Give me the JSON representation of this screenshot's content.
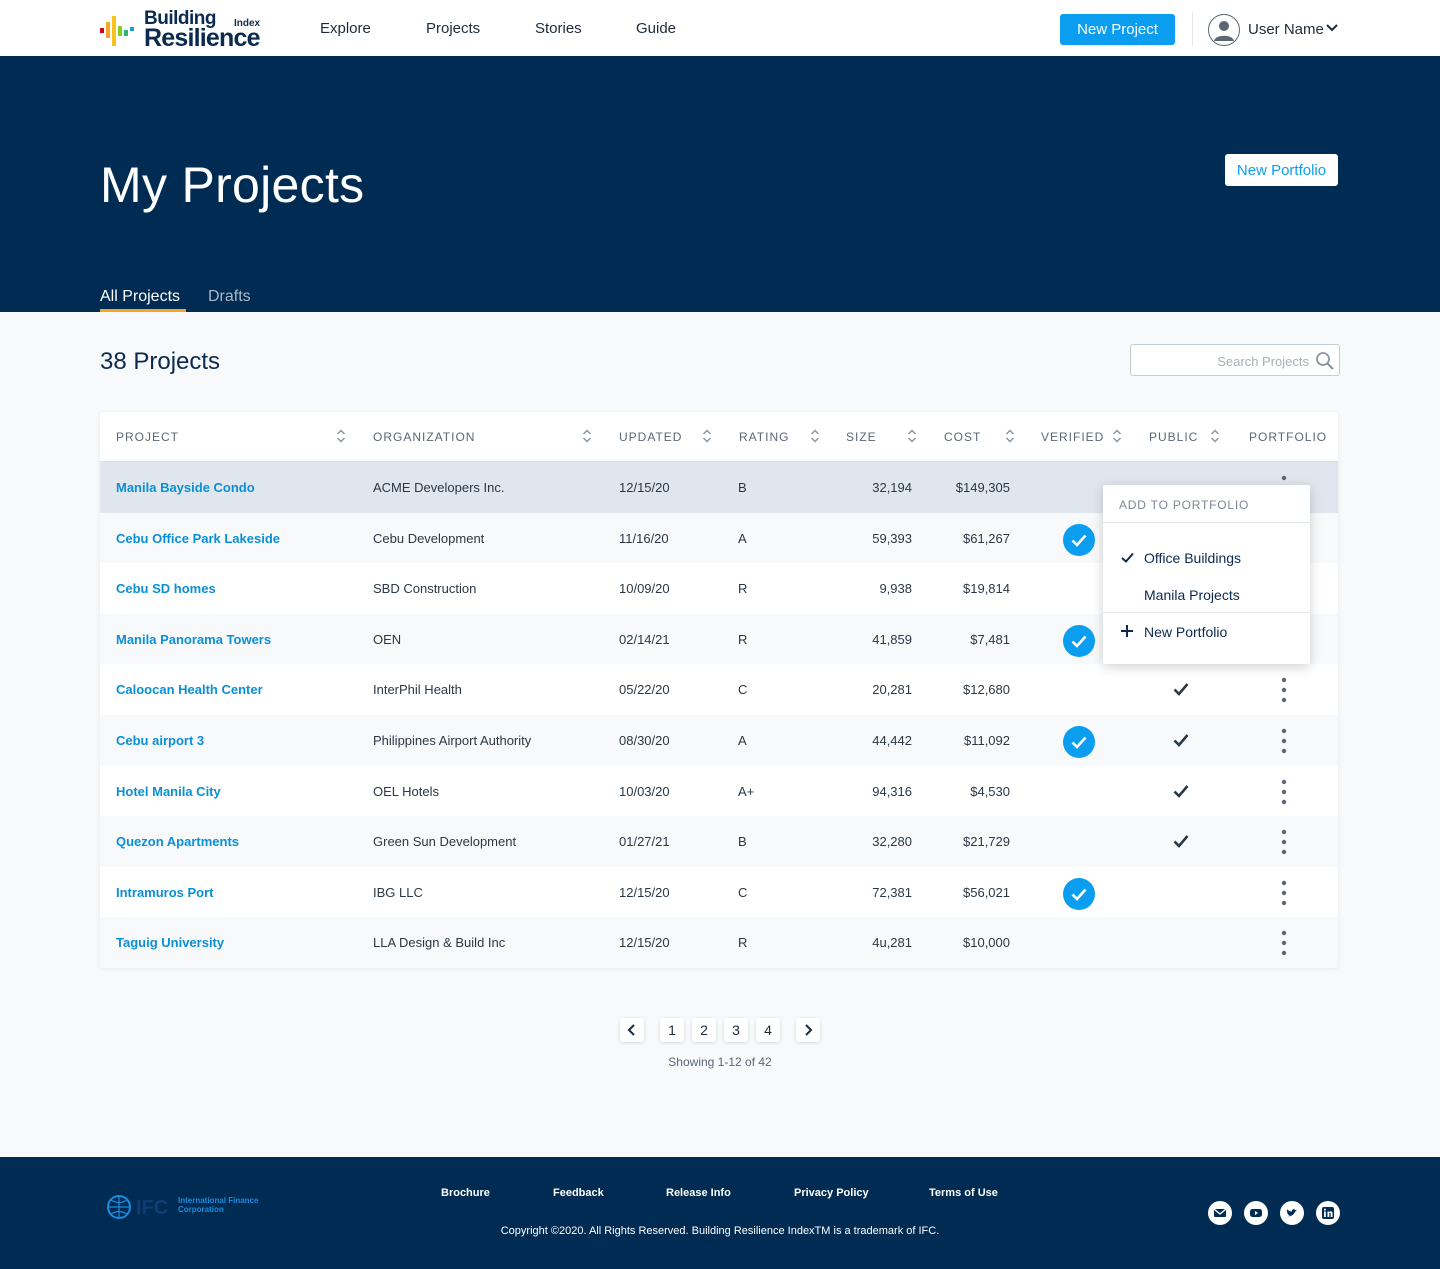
{
  "app": {
    "logo_line1": "Building",
    "logo_line2": "Resilience",
    "logo_index": "Index"
  },
  "nav": {
    "links": [
      "Explore",
      "Projects",
      "Stories",
      "Guide"
    ],
    "new_project": "New Project",
    "user_name": "User Name"
  },
  "hero": {
    "title": "My Projects",
    "new_portfolio": "New Portfolio",
    "tabs": [
      {
        "label": "All Projects",
        "active": true
      },
      {
        "label": "Drafts",
        "active": false
      }
    ]
  },
  "content": {
    "count_title": "38 Projects",
    "search_placeholder": "Search Projects"
  },
  "table": {
    "columns": [
      "PROJECT",
      "ORGANIZATION",
      "UPDATED",
      "RATING",
      "SIZE",
      "COST",
      "VERIFIED",
      "PUBLIC",
      "PORTFOLIO"
    ],
    "rows": [
      {
        "project": "Manila Bayside Condo",
        "organization": "ACME Developers Inc.",
        "updated": "12/15/20",
        "rating": "B",
        "size": "32,194",
        "cost": "$149,305",
        "verified": false,
        "public": false
      },
      {
        "project": "Cebu Office Park Lakeside",
        "organization": "Cebu Development",
        "updated": "11/16/20",
        "rating": "A",
        "size": "59,393",
        "cost": "$61,267",
        "verified": true,
        "public": false
      },
      {
        "project": "Cebu SD homes",
        "organization": "SBD Construction",
        "updated": "10/09/20",
        "rating": "R",
        "size": "9,938",
        "cost": "$19,814",
        "verified": false,
        "public": false
      },
      {
        "project": "Manila Panorama Towers",
        "organization": "OEN",
        "updated": "02/14/21",
        "rating": "R",
        "size": "41,859",
        "cost": "$7,481",
        "verified": true,
        "public": false
      },
      {
        "project": "Caloocan Health Center",
        "organization": "InterPhil Health",
        "updated": "05/22/20",
        "rating": "C",
        "size": "20,281",
        "cost": "$12,680",
        "verified": false,
        "public": true
      },
      {
        "project": "Cebu airport 3",
        "organization": "Philippines Airport Authority",
        "updated": "08/30/20",
        "rating": "A",
        "size": "44,442",
        "cost": "$11,092",
        "verified": true,
        "public": true
      },
      {
        "project": "Hotel Manila City",
        "organization": "OEL Hotels",
        "updated": "10/03/20",
        "rating": "A+",
        "size": "94,316",
        "cost": "$4,530",
        "verified": false,
        "public": true
      },
      {
        "project": "Quezon Apartments",
        "organization": "Green Sun Development",
        "updated": "01/27/21",
        "rating": "B",
        "size": "32,280",
        "cost": "$21,729",
        "verified": false,
        "public": true
      },
      {
        "project": "Intramuros Port",
        "organization": "IBG LLC",
        "updated": "12/15/20",
        "rating": "C",
        "size": "72,381",
        "cost": "$56,021",
        "verified": true,
        "public": false
      },
      {
        "project": "Taguig University",
        "organization": "LLA Design & Build Inc",
        "updated": "12/15/20",
        "rating": "R",
        "size": "4u,281",
        "cost": "$10,000",
        "verified": false,
        "public": false
      }
    ]
  },
  "portfolio_menu": {
    "header": "ADD TO PORTFOLIO",
    "items": [
      {
        "label": "Office Buildings",
        "checked": true
      },
      {
        "label": "Manila Projects",
        "checked": false
      }
    ],
    "new_label": "New Portfolio"
  },
  "pagination": {
    "pages": [
      "1",
      "2",
      "3",
      "4"
    ],
    "info": "Showing 1-12 of 42"
  },
  "footer": {
    "ifc_name": "International Finance Corporation",
    "links": [
      "Brochure",
      "Feedback",
      "Release Info",
      "Privacy Policy",
      "Terms of Use"
    ],
    "copyright": "Copyright ©2020. All Rights Reserved. Building Resilience IndexTM is a trademark of IFC.",
    "social": [
      "mail-icon",
      "youtube-icon",
      "twitter-icon",
      "linkedin-icon"
    ]
  },
  "colors": {
    "accent": "#0b9ef0",
    "navy": "#002b52",
    "tab_underline": "#f5a623"
  }
}
